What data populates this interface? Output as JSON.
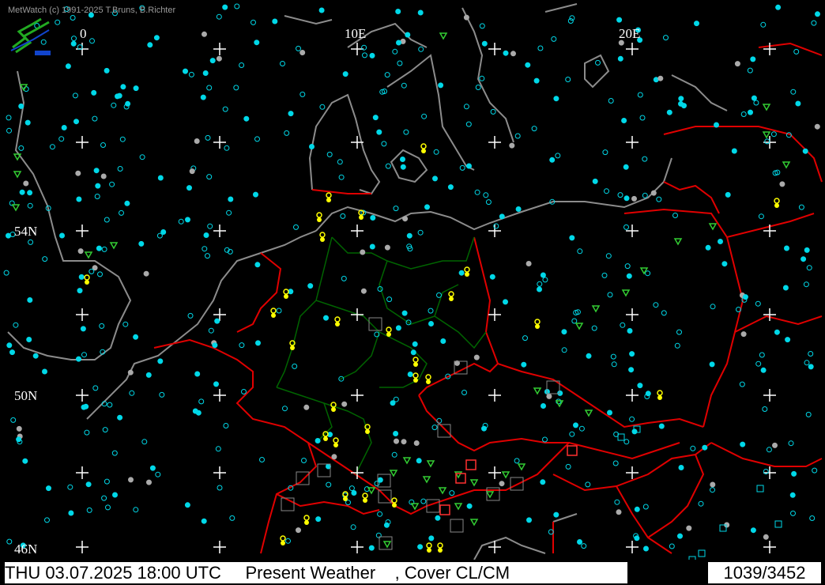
{
  "app": {
    "copyright": "MetWatch  (c) 1991-2025 T.Bruns, B.Richter"
  },
  "graticule": {
    "lon_labels": [
      "0",
      "10E",
      "20E"
    ],
    "lat_labels": [
      "54N",
      "50N",
      "46N"
    ]
  },
  "status": {
    "datetime": "THU 03.07.2025 18:00 UTC",
    "product": "Present Weather",
    "overlay": ", Cover CL/CM",
    "count": "1039/3452"
  },
  "colors": {
    "background": "#000000",
    "coastline": "#8c8c8c",
    "country_border": "#e00000",
    "state_border": "#006400",
    "station": "#00d8e8",
    "shower": "#ffff00",
    "precip": "#33cc33",
    "logo": "#22aa22"
  },
  "icons": {
    "logo": "metwatch-logo-icon",
    "station": "station-circle-icon",
    "shower": "shower-symbol-icon",
    "precip": "precip-symbol-icon"
  }
}
